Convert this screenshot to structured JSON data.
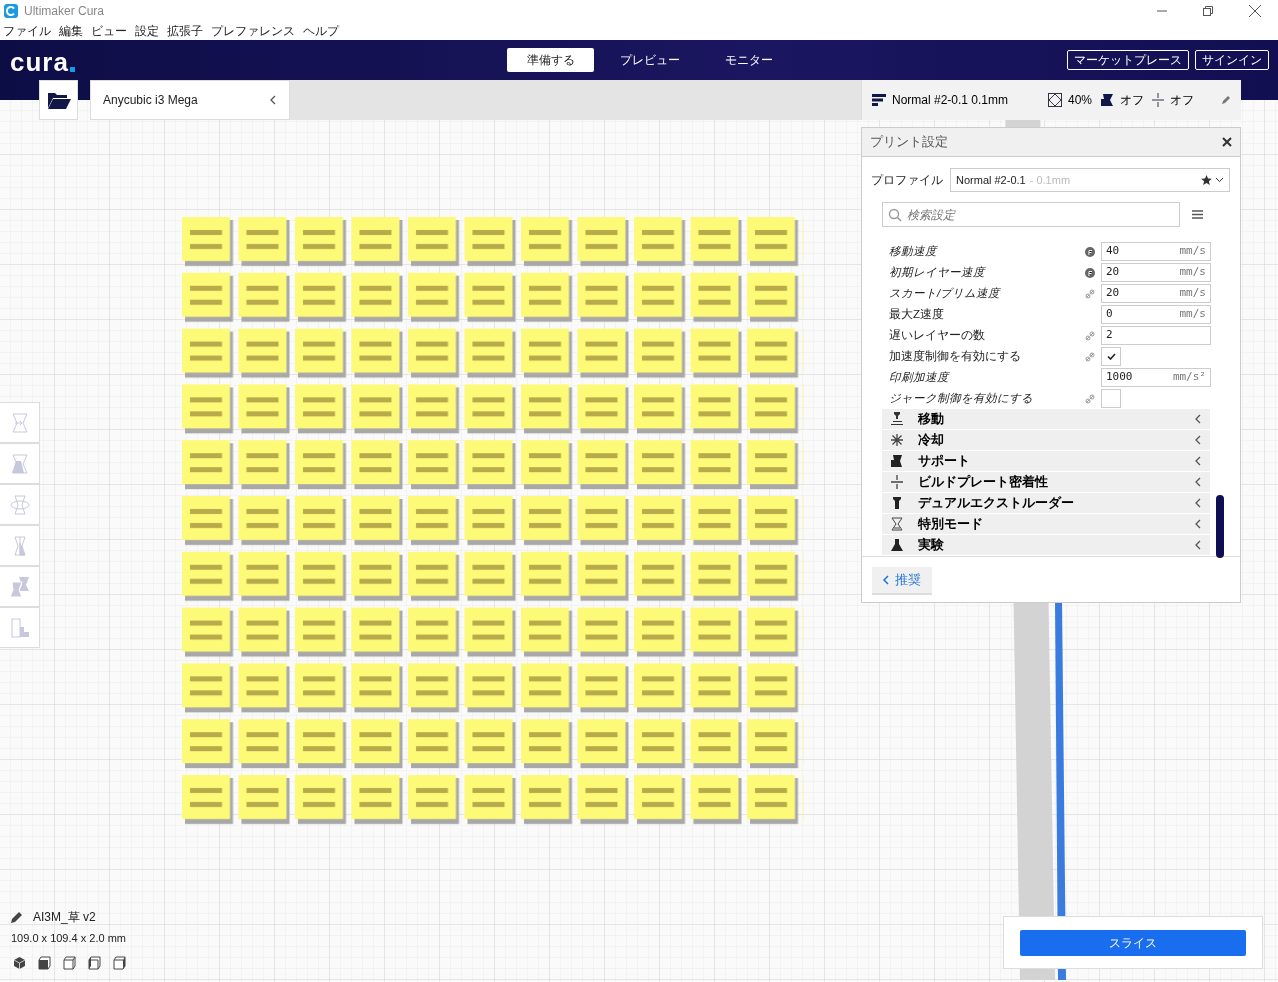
{
  "window": {
    "title": "Ultimaker Cura"
  },
  "menu": [
    "ファイル",
    "編集",
    "ビュー",
    "設定",
    "拡張子",
    "プレファレンス",
    "ヘルプ"
  ],
  "header": {
    "logo": "cura",
    "tabs": [
      {
        "label": "準備する",
        "selected": true
      },
      {
        "label": "プレビュー",
        "selected": false
      },
      {
        "label": "モニター",
        "selected": false
      }
    ],
    "buttons": [
      "マーケットプレース",
      "サインイン"
    ]
  },
  "machine": {
    "name": "Anycubic i3 Mega"
  },
  "print_summary": {
    "profile": "Normal #2-0.1 0.1mm",
    "infill": "40%",
    "support": "オフ",
    "adhesion": "オフ"
  },
  "print_settings": {
    "title": "プリント設定",
    "profile_label": "プロファイル",
    "profile_name": "Normal #2-0.1",
    "profile_detail": "- 0.1mm",
    "search": {
      "placeholder": "検索設定"
    },
    "settings": [
      {
        "label": "移動速度",
        "italic": true,
        "resettable": true,
        "linked": false,
        "kind": "field",
        "value": "40",
        "unit": "mm/s"
      },
      {
        "label": "初期レイヤー速度",
        "italic": true,
        "resettable": true,
        "linked": false,
        "kind": "field",
        "value": "20",
        "unit": "mm/s"
      },
      {
        "label": "スカート/ブリム速度",
        "italic": true,
        "resettable": false,
        "linked": true,
        "kind": "field",
        "value": "20",
        "unit": "mm/s"
      },
      {
        "label": "最大Z速度",
        "italic": false,
        "resettable": false,
        "linked": false,
        "kind": "field",
        "value": "0",
        "unit": "mm/s"
      },
      {
        "label": "遅いレイヤーの数",
        "italic": false,
        "resettable": false,
        "linked": true,
        "kind": "field",
        "value": "2"
      },
      {
        "label": "加速度制御を有効にする",
        "italic": false,
        "resettable": false,
        "linked": true,
        "kind": "checkbox",
        "checked": true
      },
      {
        "label": "印刷加速度",
        "italic": true,
        "resettable": false,
        "linked": false,
        "kind": "field",
        "value": "1000",
        "unit": "mm/s²"
      },
      {
        "label": "ジャーク制御を有効にする",
        "italic": true,
        "resettable": false,
        "linked": true,
        "kind": "checkbox",
        "checked": false
      }
    ],
    "categories": [
      "移動",
      "冷却",
      "サポート",
      "ビルドプレート密着性",
      "デュアルエクストルーダー",
      "特別モード",
      "実験"
    ],
    "recommended_button": "推奨"
  },
  "object": {
    "name": "AI3M_草 v2",
    "dimensions": "109.0 x 109.4 x 2.0 mm"
  },
  "slice_button": "スライス"
}
